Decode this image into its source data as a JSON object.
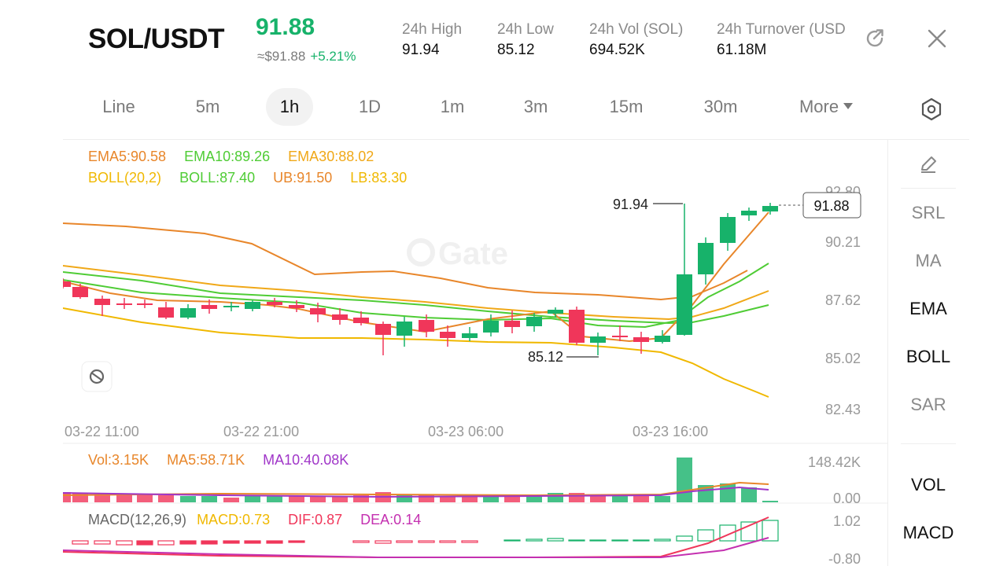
{
  "header": {
    "pair": "SOL/USDT",
    "price": "91.88",
    "approx_price": "≈$91.88",
    "change_pct": "+5.21%",
    "stats": [
      {
        "label": "24h  High",
        "value": "91.94"
      },
      {
        "label": "24h  Low",
        "value": "85.12"
      },
      {
        "label": "24h  Vol (SOL)",
        "value": "694.52K"
      },
      {
        "label": "24h  Turnover (USD",
        "value": "61.18M"
      }
    ],
    "icons": [
      "share-icon",
      "close-icon"
    ]
  },
  "tabs": [
    {
      "label": "Line",
      "active": false
    },
    {
      "label": "5m",
      "active": false
    },
    {
      "label": "1h",
      "active": true
    },
    {
      "label": "1D",
      "active": false
    },
    {
      "label": "1m",
      "active": false
    },
    {
      "label": "3m",
      "active": false
    },
    {
      "label": "15m",
      "active": false
    },
    {
      "label": "30m",
      "active": false
    },
    {
      "label": "More",
      "active": false
    }
  ],
  "legend": {
    "ema5": "EMA5:90.58",
    "ema10": "EMA10:89.26",
    "ema30": "EMA30:88.02",
    "boll_params": "BOLL(20,2)",
    "boll": "BOLL:87.40",
    "ub": "UB:91.50",
    "lb": "LB:83.30",
    "vol": "Vol:3.15K",
    "vol_ma5": "MA5:58.71K",
    "vol_ma10": "MA10:40.08K",
    "macd_params": "MACD(12,26,9)",
    "macd": "MACD:0.73",
    "dif": "DIF:0.87",
    "dea": "DEA:0.14"
  },
  "colors": {
    "up": "#17b26a",
    "down": "#f0365a",
    "ema5": "#e8862a",
    "ema10": "#4fcc35",
    "ema30": "#f0a818",
    "boll_band": "#f0b800",
    "vol_ma10": "#a036c8",
    "dea": "#c430b0"
  },
  "price_axis": [
    "92.80",
    "90.21",
    "87.62",
    "85.02",
    "82.43"
  ],
  "time_axis": [
    "03-22 11:00",
    "03-22 21:00",
    "03-23 06:00",
    "03-23 16:00"
  ],
  "high_marker": "91.94",
  "low_marker": "85.12",
  "last_price_tag": "91.88",
  "volume_axis": [
    "148.42K",
    "0.00"
  ],
  "macd_axis": [
    "1.02",
    "-0.80"
  ],
  "watermark": "Gate",
  "side_panel": {
    "main": [
      "SRL",
      "MA",
      "EMA",
      "BOLL",
      "SAR"
    ],
    "sub": [
      "VOL",
      "MACD"
    ]
  }
}
